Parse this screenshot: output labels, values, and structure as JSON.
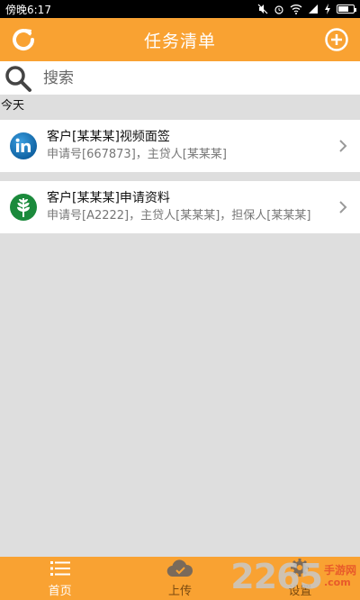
{
  "status_bar": {
    "time": "傍晚6:17"
  },
  "header": {
    "title": "任务清单",
    "refresh_icon": "refresh-icon",
    "add_icon": "add-circle-icon"
  },
  "search": {
    "placeholder": "搜索",
    "icon": "search-icon"
  },
  "section": {
    "label": "今天"
  },
  "tasks": [
    {
      "title": "客户[某某某]视频面签",
      "subtitle": "申请号[667873]，主贷人[某某某]",
      "icon": "linkedin-icon"
    },
    {
      "title": "客户[某某某]申请资料",
      "subtitle": "申请号[A2222]，主贷人[某某某]，担保人[某某某]",
      "icon": "leaf-icon"
    }
  ],
  "tabs": [
    {
      "label": "首页",
      "icon": "list-icon"
    },
    {
      "label": "上传",
      "icon": "cloud-upload-icon"
    },
    {
      "label": "设置",
      "icon": "gear-icon"
    }
  ],
  "watermark": {
    "number": "2265",
    "text": "手游网",
    "domain": ".com"
  },
  "colors": {
    "accent": "#f9a232",
    "background": "#dedede"
  }
}
